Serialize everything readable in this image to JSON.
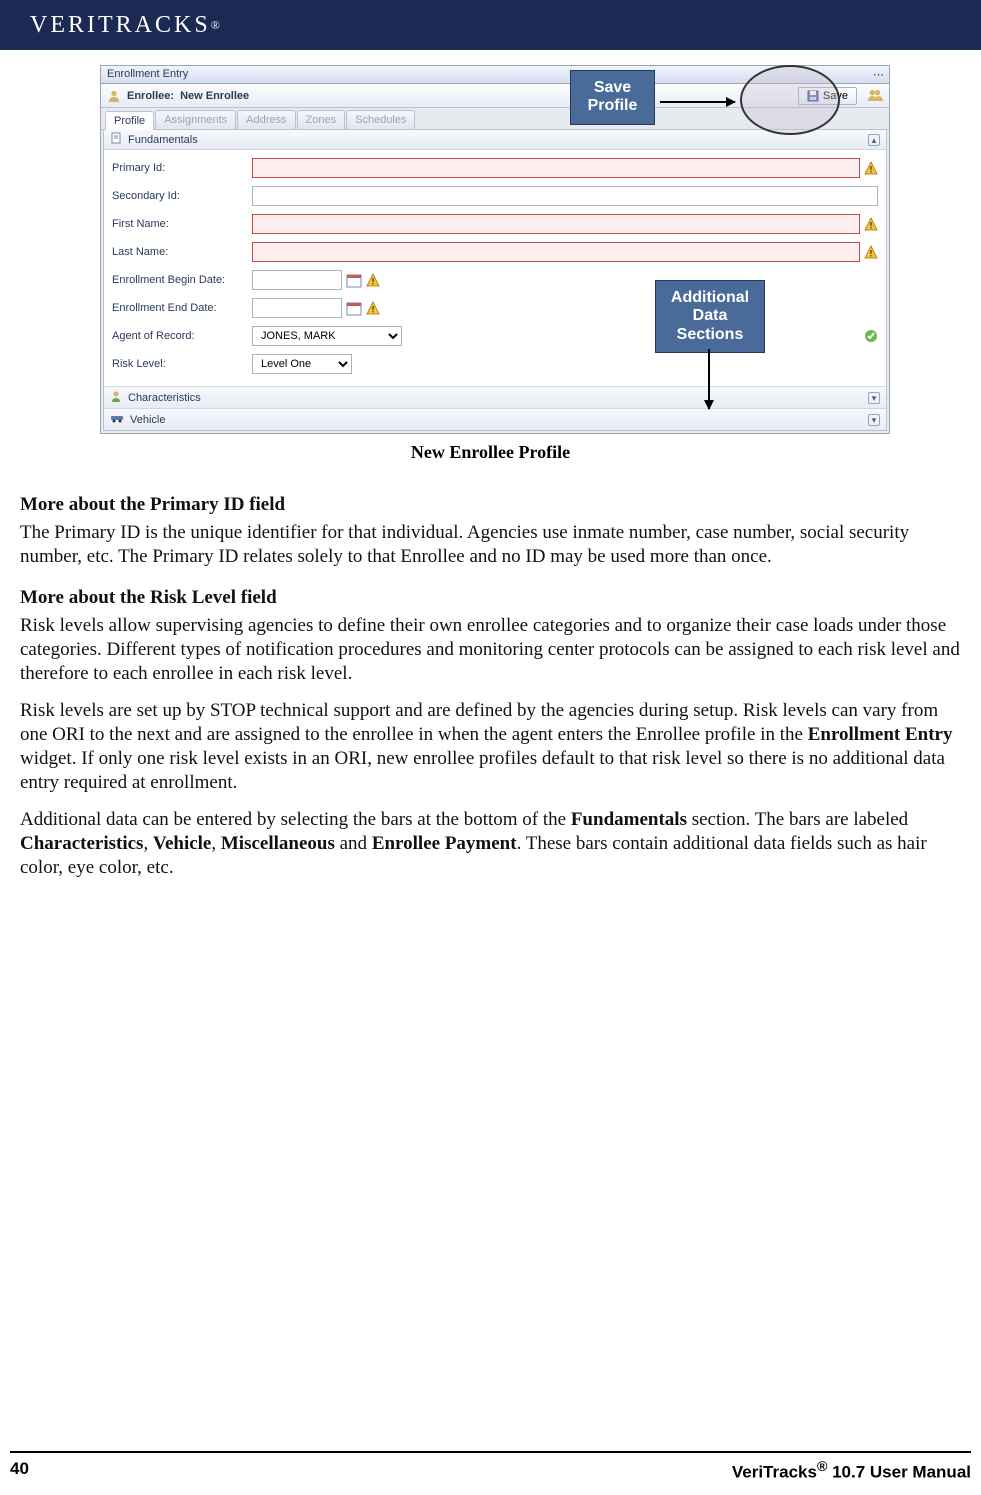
{
  "brand": "VERITRACKS",
  "reg": "®",
  "callouts": {
    "save": "Save Profile",
    "sections": "Additional Data Sections"
  },
  "window": {
    "title": "Enrollment Entry",
    "subtitle_label": "Enrollee:",
    "subtitle_value": "New Enrollee",
    "save_label": "Save",
    "tabs": [
      "Profile",
      "Assignments",
      "Address",
      "Zones",
      "Schedules"
    ],
    "section_fundamentals": "Fundamentals",
    "section_characteristics": "Characteristics",
    "section_vehicle": "Vehicle",
    "fields": {
      "primary": "Primary Id:",
      "secondary": "Secondary Id:",
      "first": "First Name:",
      "last": "Last Name:",
      "begin": "Enrollment Begin Date:",
      "end": "Enrollment End Date:",
      "agent": "Agent of Record:",
      "risk": "Risk Level:"
    },
    "agent_value": "JONES, MARK",
    "risk_value": "Level One"
  },
  "caption": "New Enrollee Profile",
  "body": {
    "h1": "More about the Primary ID field",
    "p1": "The Primary ID is the unique identifier for that individual.  Agencies use inmate number, case number, social security number, etc.  The Primary ID relates solely to that Enrollee and no ID may be used more than once.",
    "h2": "More about the Risk Level field",
    "p2": "Risk levels allow supervising agencies to define their own enrollee categories and to organize their case loads under those categories.  Different types of notification procedures and monitoring center protocols can be assigned to each risk level and therefore to each enrollee in each risk level.",
    "p3a": "Risk levels are set up by STOP technical support and are defined by the agencies during setup.  Risk levels can vary from one ORI to the next and are assigned to the enrollee in when the agent enters the Enrollee profile in the ",
    "p3b": "Enrollment Entry",
    "p3c": " widget.  If only one risk level exists in an ORI, new enrollee profiles default to that risk level so there is no additional data entry required at enrollment.",
    "p4a": "Additional data can be entered by selecting the bars at the bottom of the ",
    "p4b": "Fundamentals",
    "p4c": " section.  The bars are labeled ",
    "p4d": "Characteristics",
    "p4e": ", ",
    "p4f": "Vehicle",
    "p4g": ", ",
    "p4h": "Miscellaneous",
    "p4i": " and ",
    "p4j": "Enrollee Payment",
    "p4k": ". These bars contain additional data fields such as hair color, eye color, etc."
  },
  "footer": {
    "page": "40",
    "title_a": "VeriTracks",
    "title_b": "®",
    "title_c": " 10.7 User Manual"
  }
}
